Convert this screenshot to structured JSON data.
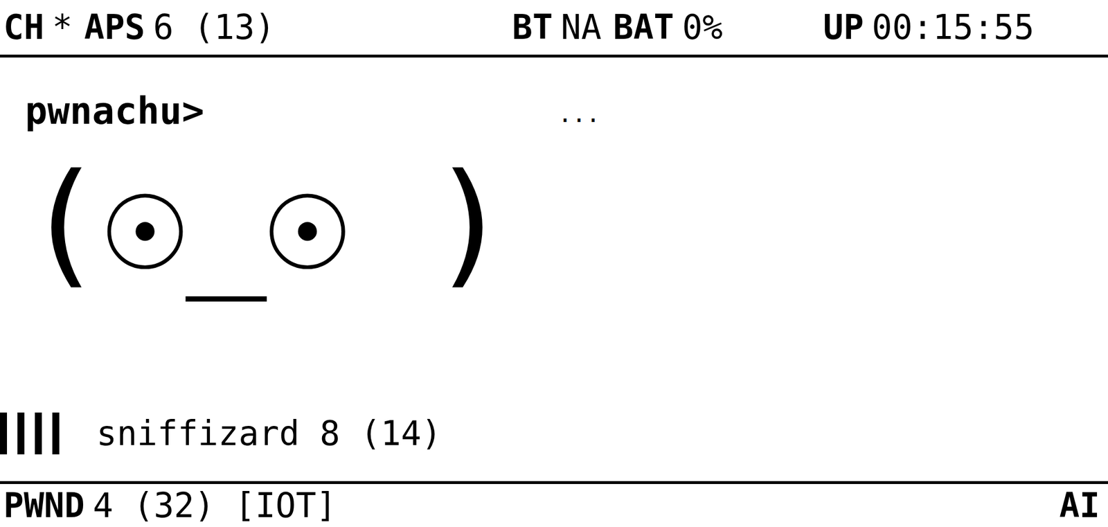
{
  "top_bar": {
    "groups": [
      [
        {
          "label": "CH",
          "value": "*"
        },
        {
          "label": "APS",
          "value": "6 (13)"
        }
      ],
      [
        {
          "label": "BT",
          "value": "NA"
        },
        {
          "label": "BAT",
          "value": "0%"
        }
      ],
      [
        {
          "label": "UP",
          "value": "00:15:55"
        }
      ]
    ]
  },
  "name": "pwnachu>",
  "status": "...",
  "face": "(☉_☉ )",
  "friend": {
    "bars": 4,
    "name": "sniffizard 8 (14)"
  },
  "bottom_bar": {
    "pwnd": {
      "label": "PWND",
      "value": "4 (32) [IOT]"
    },
    "mode": "AI"
  }
}
